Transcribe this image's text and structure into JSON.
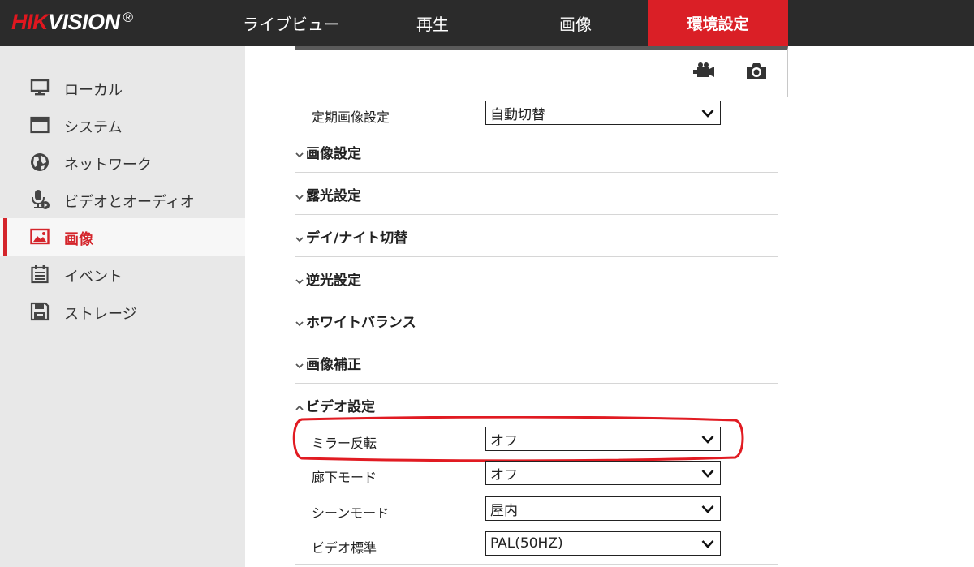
{
  "brand": {
    "name_red": "HIK",
    "name_white": "VISION",
    "reg": "®"
  },
  "nav": {
    "items": [
      {
        "label": "ライブビュー"
      },
      {
        "label": "再生"
      },
      {
        "label": "画像"
      },
      {
        "label": "環境設定",
        "active": true
      }
    ]
  },
  "sidebar": {
    "items": [
      {
        "label": "ローカル",
        "icon": "monitor-icon"
      },
      {
        "label": "システム",
        "icon": "window-icon"
      },
      {
        "label": "ネットワーク",
        "icon": "globe-icon"
      },
      {
        "label": "ビデオとオーディオ",
        "icon": "microphone-icon"
      },
      {
        "label": "画像",
        "icon": "image-icon",
        "active": true
      },
      {
        "label": "イベント",
        "icon": "calendar-icon"
      },
      {
        "label": "ストレージ",
        "icon": "floppy-disk-icon"
      }
    ]
  },
  "preview": {
    "icons": [
      "record-icon",
      "camera-icon"
    ]
  },
  "schedule": {
    "label": "定期画像設定",
    "value": "自動切替"
  },
  "sections": [
    {
      "title": "画像設定",
      "expanded": false
    },
    {
      "title": "露光設定",
      "expanded": false
    },
    {
      "title": "デイ/ナイト切替",
      "expanded": false
    },
    {
      "title": "逆光設定",
      "expanded": false
    },
    {
      "title": "ホワイトバランス",
      "expanded": false
    },
    {
      "title": "画像補正",
      "expanded": false
    },
    {
      "title": "ビデオ設定",
      "expanded": true
    }
  ],
  "video_settings": [
    {
      "label": "ミラー反転",
      "value": "オフ"
    },
    {
      "label": "廊下モード",
      "value": "オフ"
    },
    {
      "label": "シーンモード",
      "value": "屋内"
    },
    {
      "label": "ビデオ標準",
      "value": "PAL(50HZ)"
    }
  ],
  "colors": {
    "accent": "#da1f26",
    "topbar": "#2b2b2b",
    "sidebar": "#e8e8e8",
    "highlight_ring": "#e11b22"
  }
}
